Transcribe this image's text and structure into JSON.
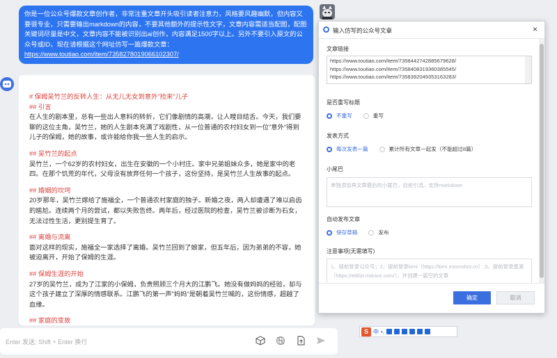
{
  "user_message": {
    "text": "你是一位公众号爆款文章创作者，非常注重文章开头吸引读者注意力，风格要风趣幽默，但内容又要很专业，只需要输出markdown的内容，不要其他额外的提示性文字，文章内容需适当配图，配图关键词尽量是中文，文章内容不能被识别出ai创作，内容满足1500字以上。另外不要引入原文的公众号或ID，现在请根据这个网址仿写一篇爆款文章：",
    "link": "https://www.toutiao.com/item/7358278019066102307/"
  },
  "article": {
    "title_line": "# 保姆吴竹兰的反转人生：从无儿无女到意外\"捡来\"儿子",
    "sections": [
      {
        "heading": "## 引言",
        "body": "在人生的剧本里，总有一些出人意料的转折，它们像剧情的高潮，让人瞠目结舌。今天，我们要聊的这位主角，吴竹兰，她的人生剧本充满了戏剧性，从一位普通的农村妇女到一位\"意外\"得到儿子的保姆，她的故事，或许能给你我一些人生的启示。"
      },
      {
        "heading": "## 吴竹兰的起点",
        "body": "吴竹兰，一个62岁的农村妇女，出生在安徽的一个小村庄。家中兄弟姐妹众多，她是家中的老四。在那个饥荒的年代，父母没有放弃任何一个孩子，这份坚持，是吴竹兰人生故事的起点。"
      },
      {
        "heading": "## 婚姻的坎坷",
        "body": "20岁那年，吴竹兰嫁给了施福全，一个普通农村家庭的独子。新婚之夜，两人却遭遇了难以启齿的尴尬。连续两个月的尝试，都以失败告终。两年后，经过医院的检查，吴竹兰被诊断为石女，无法过性生活，更别提生育了。"
      },
      {
        "heading": "## 离婚与流离",
        "body": "面对这样的现实，施福全一家选择了离婚。吴竹兰回到了娘家，但五年后，因为弟弟的不容，她被迫离开，开始了保姆的生涯。"
      },
      {
        "heading": "## 保姆生涯的开始",
        "body": "27岁的吴竹兰，成为了江家的小保姆，负责照顾三个月大的江鹏飞。她没有做妈妈的经验，却与这个孩子建立了深厚的情感联系。江鹏飞的第一声\"妈妈\"是朝着吴竹兰喊的，这份情感，超越了血缘。"
      },
      {
        "heading": "## 家庭的变故",
        "body": ""
      }
    ]
  },
  "input_bar": {
    "placeholder": "Enter 发送; Shift + Enter 换行"
  },
  "modal": {
    "title": "输入仿写的公众号文章",
    "close": "×",
    "link_label": "文章链接",
    "urls": [
      "https://www.toutiao.com/item/7358442742885679628/",
      "https://www.toutiao.com/item/7358408319360385545/",
      "https://www.toutiao.com/item/7358392049353163283/"
    ],
    "rewrite_title_label": "是否重写标题",
    "rewrite_options": [
      "不重写",
      "重写"
    ],
    "publish_mode_label": "发表方式",
    "publish_mode_options": [
      "每次发表一篇",
      "累计所有文章一起发（不能超过8篇）"
    ],
    "tail_label": "小尾巴",
    "tail_placeholder": "单独添加再文章最后的小尾巴，目前引流。支持markdown",
    "auto_publish_label": "自动发布文章",
    "auto_publish_options": [
      "保存草稿",
      "发布"
    ],
    "notes_label": "注意事项(无需填写)",
    "notes_text": "1、提前登录公众号；2、提前登录kimi（https://kimi.moonshot.cn）;3、提前登录墨滴（https://editor.mdnice.com/），并创建一篇空的文章",
    "ok": "确定",
    "cancel": "取消"
  },
  "ime": {
    "logo": "S",
    "mode": "中"
  }
}
